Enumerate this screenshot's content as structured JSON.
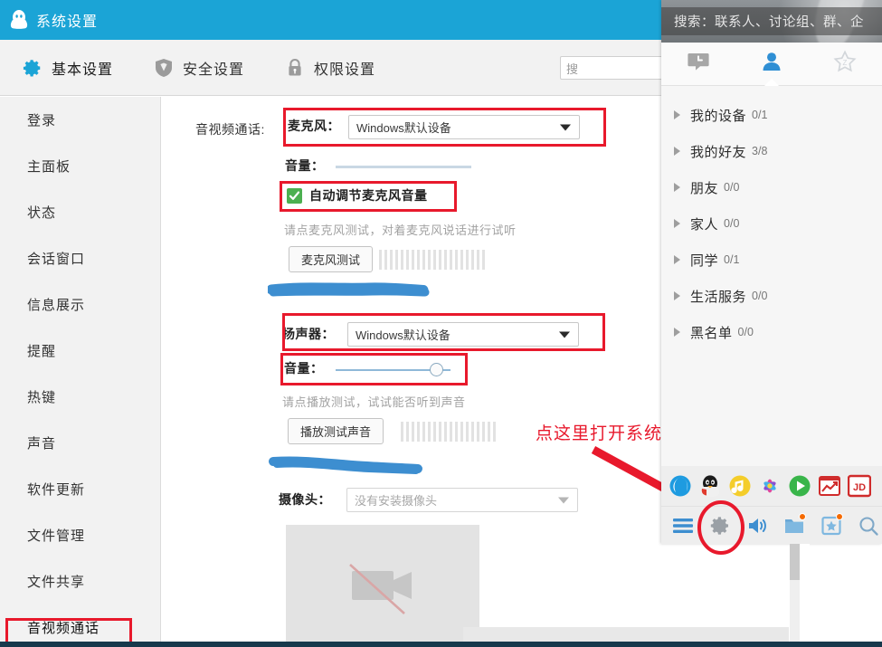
{
  "window": {
    "title": "系统设置",
    "logo_icon": "qq-penguin-icon"
  },
  "tabs": [
    {
      "label": "基本设置",
      "icon": "gear-icon",
      "active": true
    },
    {
      "label": "安全设置",
      "icon": "shield-icon",
      "active": false
    },
    {
      "label": "权限设置",
      "icon": "lock-icon",
      "active": false
    }
  ],
  "search": {
    "value": "搜",
    "placeholder": "搜索"
  },
  "sidebar": {
    "items": [
      {
        "label": "登录"
      },
      {
        "label": "主面板"
      },
      {
        "label": "状态"
      },
      {
        "label": "会话窗口"
      },
      {
        "label": "信息展示"
      },
      {
        "label": "提醒"
      },
      {
        "label": "热键"
      },
      {
        "label": "声音"
      },
      {
        "label": "软件更新"
      },
      {
        "label": "文件管理"
      },
      {
        "label": "文件共享"
      },
      {
        "label": "音视频通话"
      }
    ],
    "selected_index": 11
  },
  "content": {
    "section_label": "音视频通话:",
    "microphone": {
      "label": "麦克风：",
      "device": "Windows默认设备",
      "volume_label": "音量：",
      "volume_percent": 0,
      "volume_enabled": false,
      "auto_adjust_label": "自动调节麦克风音量",
      "auto_adjust_checked": true,
      "hint": "请点麦克风测试，对着麦克风说话进行试听",
      "test_button": "麦克风测试",
      "meter_bars": 20
    },
    "speaker": {
      "label": "扬声器：",
      "device": "Windows默认设备",
      "volume_label": "音量：",
      "volume_percent": 88,
      "volume_enabled": true,
      "hint": "请点播放测试，试试能否听到声音",
      "test_button": "播放测试声音",
      "meter_bars": 18
    },
    "camera": {
      "label": "摄像头：",
      "device": "没有安装摄像头",
      "disabled": true,
      "preview_icon": "camera-off-icon"
    }
  },
  "annotation": {
    "text": "点这里打开系统设置",
    "color": "#e8192c",
    "arrow_icon": "arrow-down-right-icon",
    "ellipse_target": "gear-icon"
  },
  "qq_panel": {
    "search_text": "搜索：联系人、讨论组、群、企",
    "tabs": [
      {
        "icon": "message-icon",
        "active": false
      },
      {
        "icon": "contacts-icon",
        "active": true
      },
      {
        "icon": "star-group-icon",
        "active": false
      }
    ],
    "groups": [
      {
        "name": "我的设备",
        "count": "0/1"
      },
      {
        "name": "我的好友",
        "count": "3/8"
      },
      {
        "name": "朋友",
        "count": "0/0"
      },
      {
        "name": "家人",
        "count": "0/0"
      },
      {
        "name": "同学",
        "count": "0/1"
      },
      {
        "name": "生活服务",
        "count": "0/0"
      },
      {
        "name": "黑名单",
        "count": "0/0"
      }
    ],
    "app_icons": [
      "browser-icon",
      "qq-penguin-icon",
      "qq-music-icon",
      "flower-app-icon",
      "play-store-icon",
      "stock-app-icon",
      "jd-app-icon"
    ],
    "bottom_icons": [
      "menu-icon",
      "gear-icon",
      "speaker-icon",
      "folder-icon",
      "bookmark-icon",
      "search-icon"
    ]
  },
  "colors": {
    "header_blue": "#1ba4d6",
    "accent_red": "#e8192c",
    "scribble_blue": "#3d8ed0",
    "checkbox_green": "#4cb050"
  }
}
